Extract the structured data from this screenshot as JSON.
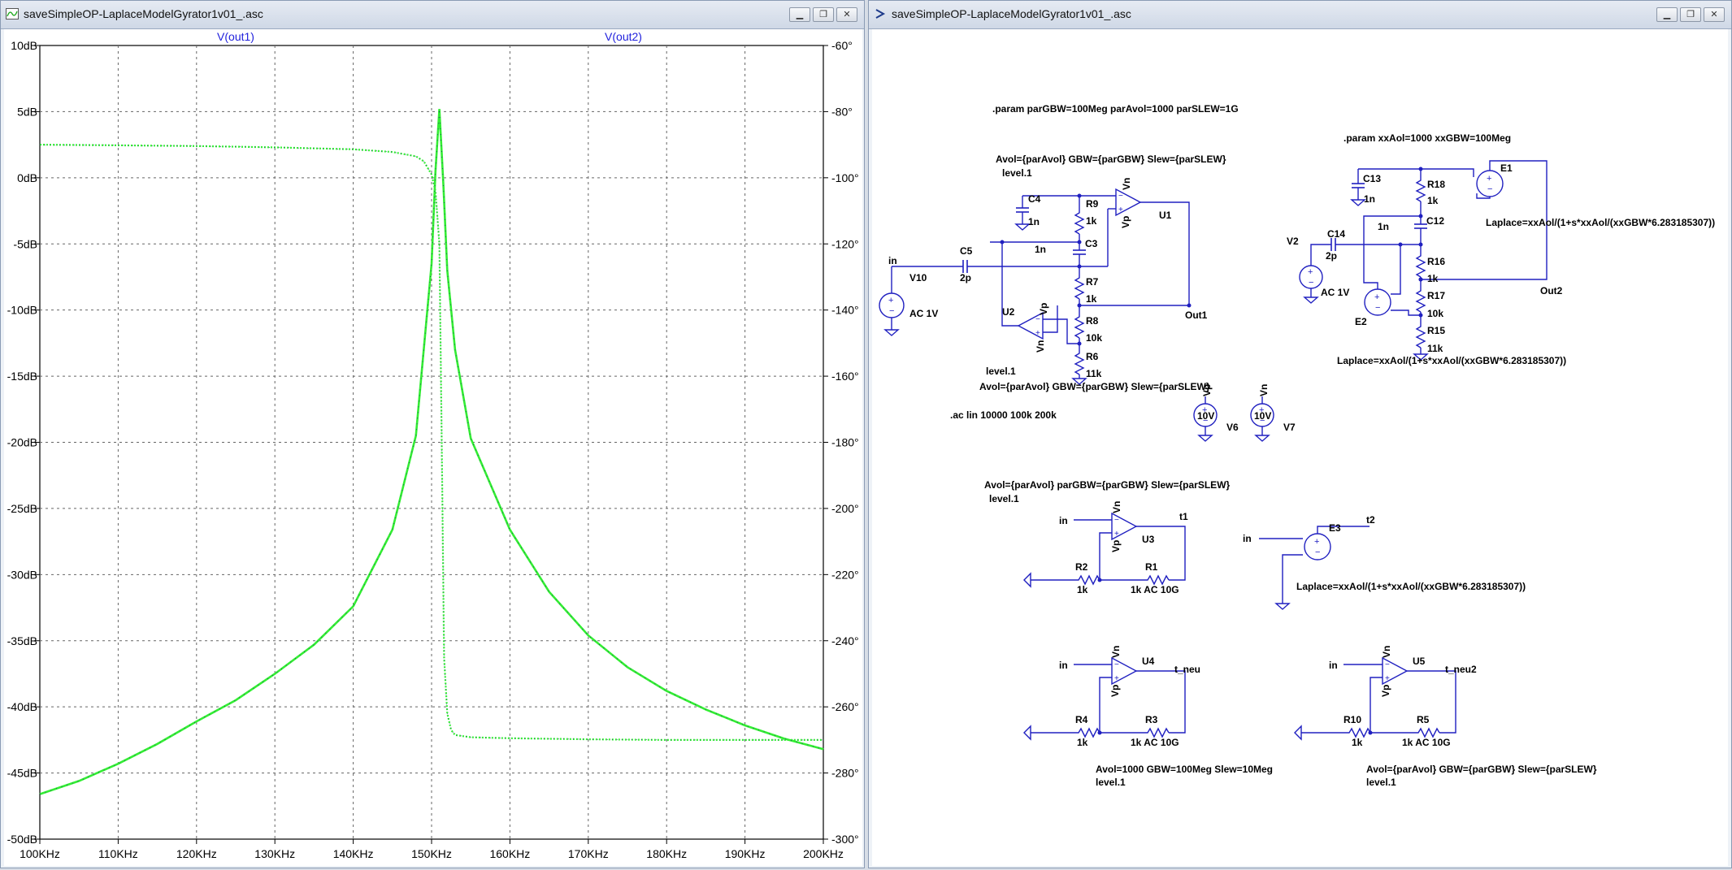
{
  "left_window": {
    "title": "saveSimpleOP-LaplaceModelGyrator1v01_.asc",
    "icon": "waveform-viewer-icon",
    "buttons": [
      "minimize-icon",
      "restore-icon",
      "close-icon"
    ]
  },
  "right_window": {
    "title": "saveSimpleOP-LaplaceModelGyrator1v01_.asc",
    "icon": "schematic-icon",
    "buttons": [
      "minimize-icon",
      "restore-icon",
      "close-icon"
    ]
  },
  "chart_data": {
    "type": "line",
    "title": "",
    "xlabel": "",
    "ylabel": "",
    "x_ticks": [
      "100KHz",
      "110KHz",
      "120KHz",
      "130KHz",
      "140KHz",
      "150KHz",
      "160KHz",
      "170KHz",
      "180KHz",
      "190KHz",
      "200KHz"
    ],
    "y_ticks_left": [
      "10dB",
      "5dB",
      "0dB",
      "-5dB",
      "-10dB",
      "-15dB",
      "-20dB",
      "-25dB",
      "-30dB",
      "-35dB",
      "-40dB",
      "-45dB",
      "-50dB"
    ],
    "y_ticks_right": [
      "-60°",
      "-80°",
      "-100°",
      "-120°",
      "-140°",
      "-160°",
      "-180°",
      "-200°",
      "-220°",
      "-240°",
      "-260°",
      "-280°",
      "-300°"
    ],
    "xlim": [
      100,
      200
    ],
    "ylim_left": [
      -50,
      10
    ],
    "ylim_right": [
      -300,
      -60
    ],
    "grid": true,
    "legend": "top",
    "colors": {
      "out1": "#1f1fdc",
      "out2": "#33ee33",
      "phase": "#1a1a7a"
    },
    "series": [
      {
        "name": "V(out1)",
        "color": "#1f1fdc"
      },
      {
        "name": "V(out2)",
        "color": "#33ee33"
      }
    ],
    "magnitude_db": {
      "x": [
        100,
        105,
        110,
        115,
        120,
        125,
        130,
        135,
        140,
        145,
        148,
        150,
        150.5,
        151,
        151.5,
        152,
        153,
        155,
        160,
        165,
        170,
        175,
        180,
        185,
        190,
        195,
        200
      ],
      "y": [
        -46.6,
        -45.6,
        -44.3,
        -42.8,
        -41.1,
        -39.5,
        -37.5,
        -35.3,
        -32.4,
        -26.6,
        -19.5,
        -6.5,
        0.5,
        5.2,
        -0.5,
        -7,
        -13,
        -19.7,
        -26.6,
        -31.3,
        -34.6,
        -37.0,
        -38.8,
        -40.2,
        -41.4,
        -42.4,
        -43.2
      ]
    },
    "phase_deg": {
      "x": [
        100,
        110,
        120,
        130,
        140,
        145,
        148,
        149,
        150,
        150.5,
        151,
        151.3,
        151.6,
        152,
        152.5,
        153,
        155,
        160,
        170,
        180,
        190,
        200
      ],
      "y": [
        -90,
        -90.2,
        -90.4,
        -90.8,
        -91.4,
        -92.2,
        -93.5,
        -95,
        -99,
        -104,
        -120,
        -180,
        -245,
        -262,
        -267,
        -268.5,
        -269.2,
        -269.5,
        -269.8,
        -270,
        -270,
        -270
      ]
    }
  },
  "schematic": {
    "labels": {
      "param1": ".param parGBW=100Meg parAvol=1000 parSLEW=1G",
      "param2": ".param xxAol=1000 xxGBW=100Meg",
      "avol_top": "Avol={parAvol} GBW={parGBW} Slew={parSLEW}",
      "level1_a": "level.1",
      "level1_b": "level.1",
      "avol_u2": "Avol={parAvol} GBW={parGBW} Slew={parSLEW}",
      "ac_cmd": ".ac lin 10000 100k 200k",
      "laplace_e1": "Laplace=xxAol/(1+s*xxAol/(xxGBW*6.283185307))",
      "laplace_e2": "Laplace=xxAol/(1+s*xxAol/(xxGBW*6.283185307))",
      "laplace_e3": "Laplace=xxAol/(1+s*xxAol/(xxGBW*6.283185307))",
      "avol_u3": "Avol={parAvol} parGBW={parGBW} Slew={parSLEW}",
      "level1_u3": "level.1",
      "avol_u4": "Avol=1000 GBW=100Meg Slew=10Meg",
      "level1_u4": "level.1",
      "avol_u5": "Avol={parAvol} GBW={parGBW} Slew={parSLEW}",
      "level1_u5": "level.1"
    },
    "nets": {
      "in": "in",
      "out1": "Out1",
      "out2": "Out2",
      "t1": "t1",
      "t2": "t2",
      "t_neu": "t_neu",
      "t_neu2": "t_neu2",
      "vp": "Vp",
      "vn": "Vn"
    },
    "parts": {
      "V10": "V10",
      "V10_val": "AC 1V",
      "C5": "C5",
      "C5_val": "2p",
      "C4": "C4",
      "C4_val": "1n",
      "R9": "R9",
      "R9_val": "1k",
      "C3": "C3",
      "C3_val": "1n",
      "R7": "R7",
      "R7_val": "1k",
      "R8": "R8",
      "R8_val": "10k",
      "R6": "R6",
      "R6_val": "11k",
      "U1": "U1",
      "U2": "U2",
      "C13": "C13",
      "C13_val": "1n",
      "R18": "R18",
      "R18_val": "1k",
      "E1": "E1",
      "C12": "C12",
      "C12_val": "1n",
      "V2": "V2",
      "V2_val": "AC 1V",
      "C14": "C14",
      "C14_val": "2p",
      "R16": "R16",
      "R16_val": "1k",
      "R17": "R17",
      "R17_val": "10k",
      "E2": "E2",
      "R15": "R15",
      "R15_val": "11k",
      "V6": "V6",
      "V6_val": "10V",
      "V7": "V7",
      "V7_val": "10V",
      "U3": "U3",
      "R2": "R2",
      "R2_val": "1k",
      "R1": "R1",
      "R1_val": "1k AC 10G",
      "E3": "E3",
      "U4": "U4",
      "R4": "R4",
      "R4_val": "1k",
      "R3": "R3",
      "R3_val": "1k AC 10G",
      "U5": "U5",
      "R10": "R10",
      "R10_val": "1k",
      "R5": "R5",
      "R5_val": "1k AC 10G"
    }
  }
}
